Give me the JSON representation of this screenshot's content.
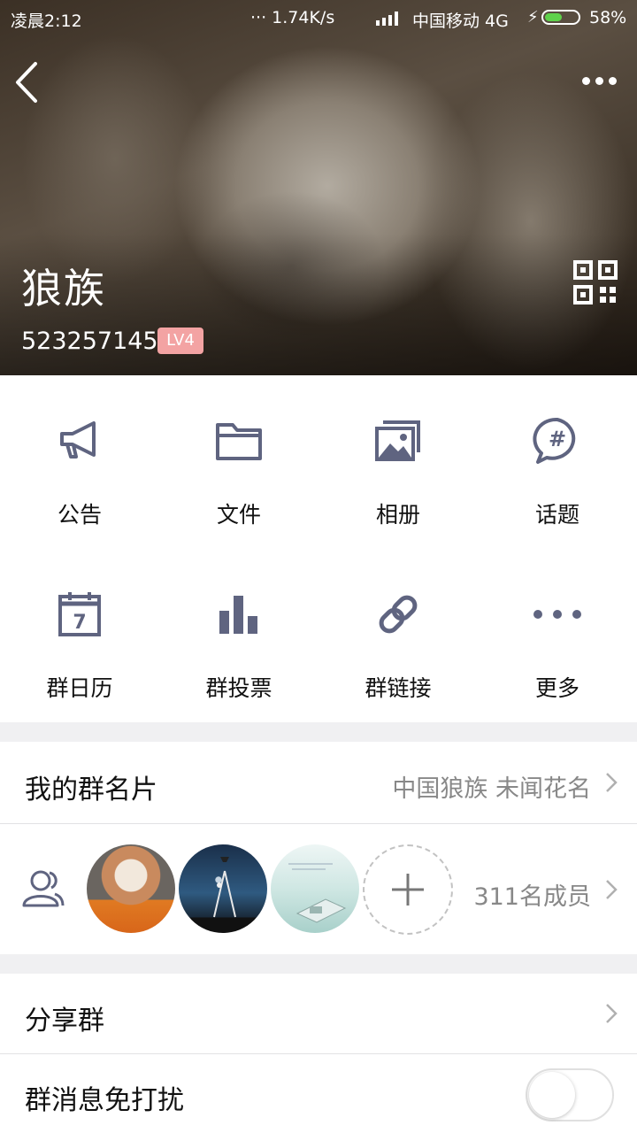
{
  "status_bar": {
    "time": "凌晨2:12",
    "net_speed": "··· 1.74K/s",
    "carrier": "中国移动 4G",
    "battery_percent": "58%",
    "battery_level": 0.58
  },
  "header": {
    "group_name": "狼族",
    "group_id": "523257145",
    "level_badge": "LV4"
  },
  "functions": [
    {
      "label": "公告",
      "icon": "megaphone-icon"
    },
    {
      "label": "文件",
      "icon": "folder-icon"
    },
    {
      "label": "相册",
      "icon": "album-icon"
    },
    {
      "label": "话题",
      "icon": "topic-hash-icon"
    },
    {
      "label": "群日历",
      "icon": "calendar-icon"
    },
    {
      "label": "群投票",
      "icon": "bar-chart-icon"
    },
    {
      "label": "群链接",
      "icon": "link-icon"
    },
    {
      "label": "更多",
      "icon": "more-dots-icon"
    }
  ],
  "my_card": {
    "title": "我的群名片",
    "value": "中国狼族 未闻花名"
  },
  "members": {
    "count_label": "311名成员"
  },
  "share": {
    "title": "分享群"
  },
  "mute": {
    "title": "群消息免打扰",
    "enabled": false
  },
  "colors": {
    "icon": "#5f6480",
    "badge": "#f3a3a3",
    "battery": "#5fd24b"
  }
}
